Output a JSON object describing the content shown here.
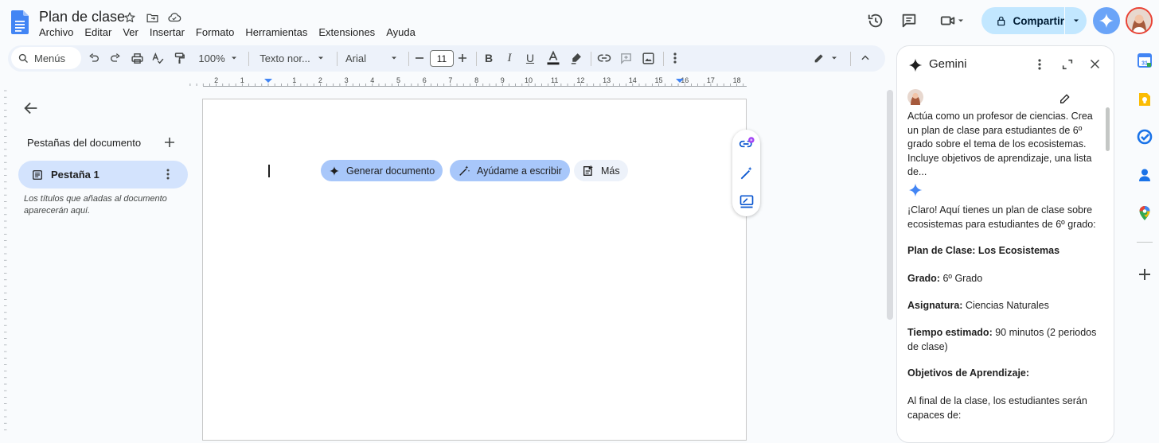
{
  "document": {
    "title": "Plan de clase",
    "menus": [
      "Archivo",
      "Editar",
      "Ver",
      "Insertar",
      "Formato",
      "Herramientas",
      "Extensiones",
      "Ayuda"
    ]
  },
  "header": {
    "share_label": "Compartir"
  },
  "toolbar": {
    "menus_label": "Menús",
    "zoom": "100%",
    "style": "Texto nor...",
    "font": "Arial",
    "font_size": "11"
  },
  "ruler": {
    "labels": [
      "2",
      "1",
      "1",
      "2",
      "3",
      "4",
      "5",
      "6",
      "7",
      "8",
      "9",
      "10",
      "11",
      "12",
      "13",
      "14",
      "15",
      "16",
      "17",
      "18"
    ]
  },
  "sidebar": {
    "tabs_title": "Pestañas del documento",
    "tabs": [
      {
        "label": "Pestaña 1"
      }
    ],
    "hint": "Los títulos que añadas al documento aparecerán aquí."
  },
  "page": {
    "chips": [
      {
        "label": "Generar documento"
      },
      {
        "label": "Ayúdame a escribir"
      },
      {
        "label": "Más"
      }
    ]
  },
  "gemini": {
    "title": "Gemini",
    "prompt": "Actúa como un profesor de ciencias. Crea un plan de clase para estudiantes de 6º grado sobre el tema de los ecosistemas. Incluye objetivos de aprendizaje, una lista de...",
    "intro": "¡Claro! Aquí tienes un plan de clase sobre ecosistemas para estudiantes de 6º grado:",
    "plan_title": "Plan de Clase: Los Ecosistemas",
    "fields": [
      {
        "label": "Grado:",
        "value": " 6º Grado"
      },
      {
        "label": "Asignatura:",
        "value": " Ciencias Naturales"
      },
      {
        "label": "Tiempo estimado:",
        "value": " 90 minutos (2 periodos de clase)"
      }
    ],
    "objectives_title": "Objetivos de Aprendizaje:",
    "objectives_intro": "Al final de la clase, los estudiantes serán capaces de:"
  },
  "colors": {
    "accent": "#0b57d0",
    "share_bg": "#c2e7ff",
    "tab_active_bg": "#d3e3fd",
    "chip_bg": "#d3e3fd",
    "toolbar_bg": "#edf2fa"
  }
}
